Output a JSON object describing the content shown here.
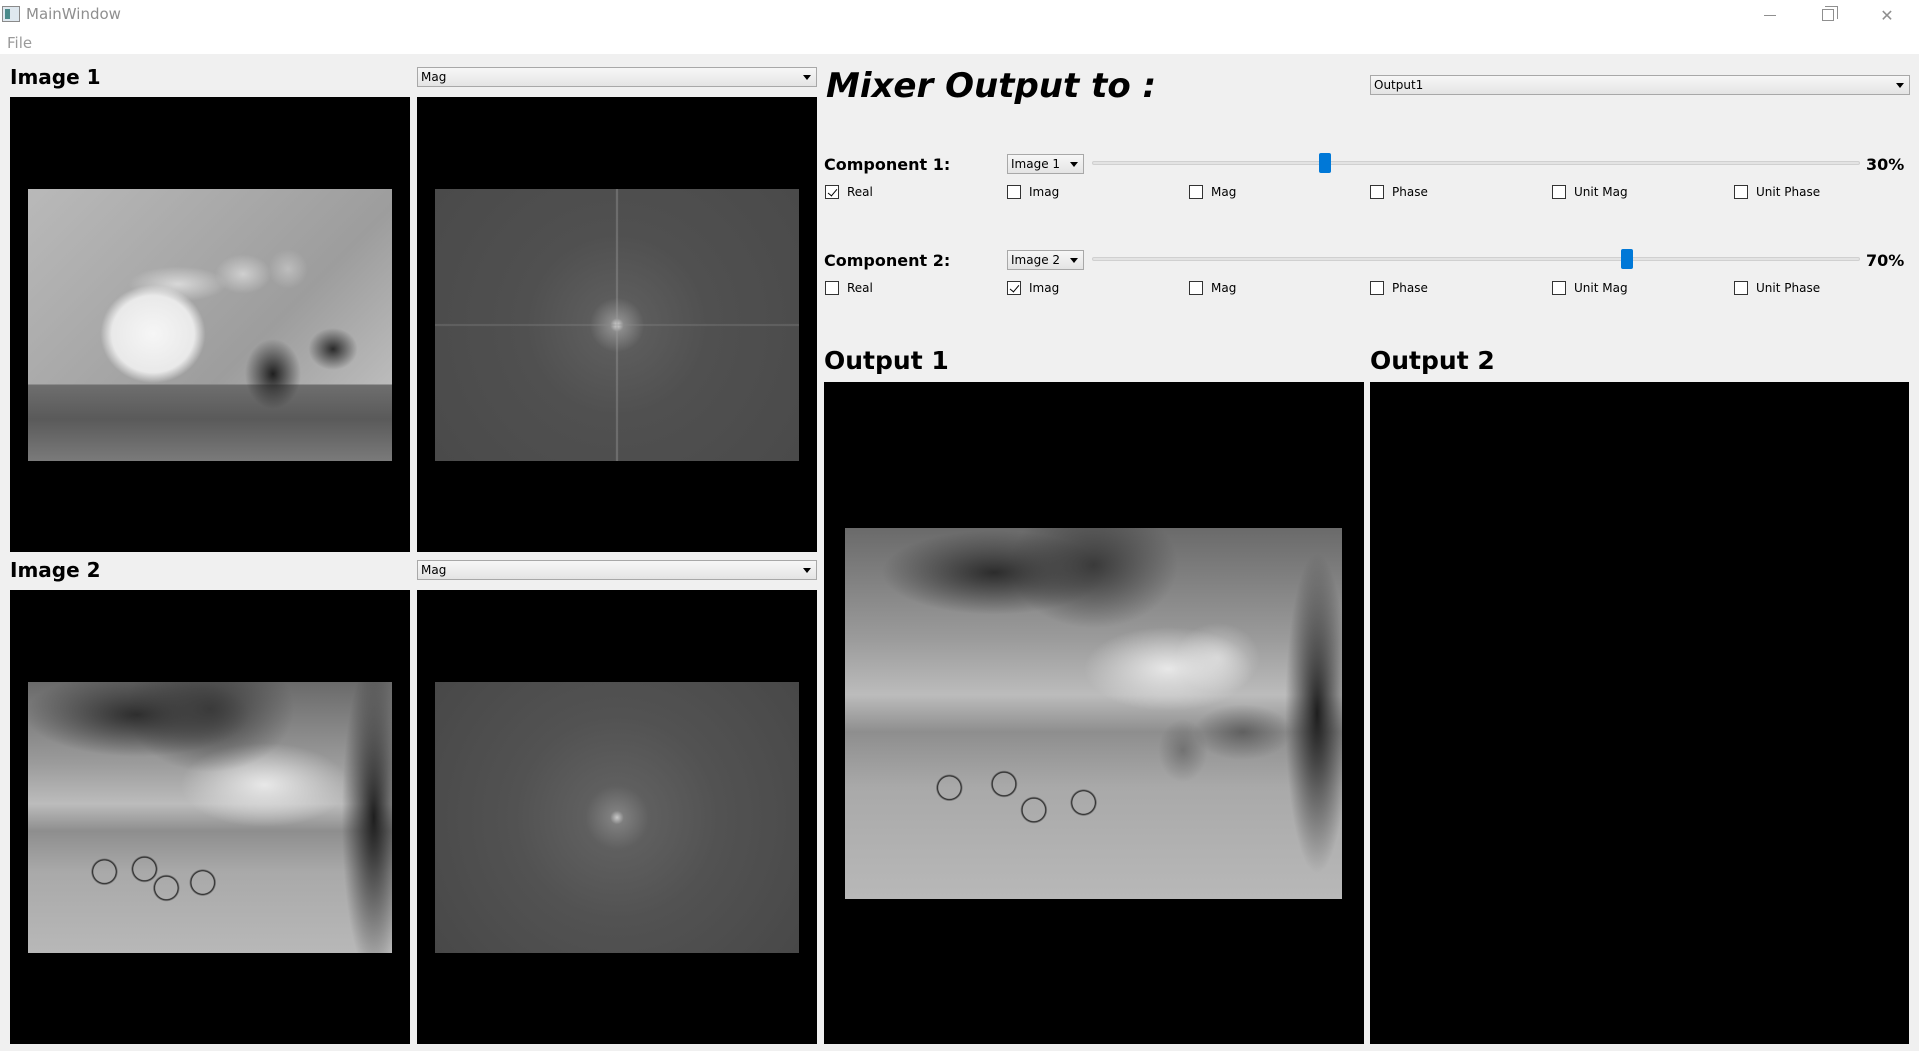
{
  "window": {
    "title": "MainWindow",
    "menu": [
      "File"
    ]
  },
  "image1": {
    "heading": "Image 1",
    "component_select": "Mag"
  },
  "image2": {
    "heading": "Image 2",
    "component_select": "Mag"
  },
  "mixer": {
    "heading": "Mixer Output to :",
    "output_select": "Output1",
    "component1": {
      "label": "Component 1:",
      "source": "Image 1",
      "percent": "30%",
      "ratio": 0.3,
      "checks": [
        {
          "label": "Real",
          "checked": true
        },
        {
          "label": "Imag",
          "checked": false
        },
        {
          "label": "Mag",
          "checked": false
        },
        {
          "label": "Phase",
          "checked": false
        },
        {
          "label": "Unit Mag",
          "checked": false
        },
        {
          "label": "Unit Phase",
          "checked": false
        }
      ]
    },
    "component2": {
      "label": "Component 2:",
      "source": "Image 2",
      "percent": "70%",
      "ratio": 0.7,
      "checks": [
        {
          "label": "Real",
          "checked": false
        },
        {
          "label": "Imag",
          "checked": true
        },
        {
          "label": "Mag",
          "checked": false
        },
        {
          "label": "Phase",
          "checked": false
        },
        {
          "label": "Unit Mag",
          "checked": false
        },
        {
          "label": "Unit Phase",
          "checked": false
        }
      ]
    }
  },
  "output1": {
    "heading": "Output 1"
  },
  "output2": {
    "heading": "Output 2"
  },
  "colors": {
    "slider_handle": "#0078d7",
    "viewer_background": "#000000",
    "window_background": "#f0f0f0"
  }
}
